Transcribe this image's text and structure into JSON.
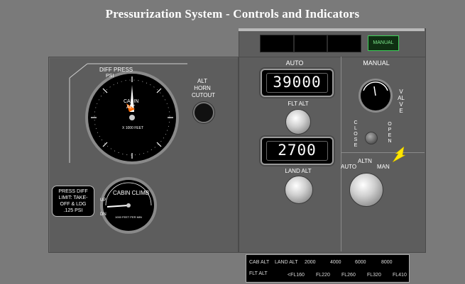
{
  "title": "Pressurization System - Controls and Indicators",
  "top_windows": {
    "manual_button": "MANUAL"
  },
  "left_panel": {
    "diff_press_gauge": {
      "label_top": "DIFF PRESS",
      "label_psi": "PSI",
      "label_cabin": "CABIN",
      "label_alt": "ALT",
      "label_feet": "X 1000 FEET",
      "scale_values": [
        "0",
        "5",
        "10",
        "15",
        "20",
        "25",
        "30",
        "35",
        "40",
        "45",
        "50"
      ],
      "psi_values": [
        "0",
        "2",
        "4",
        "6",
        "8",
        "10"
      ]
    },
    "alt_horn_cutout": {
      "line1": "ALT",
      "line2": "HORN",
      "line3": "CUTOUT"
    },
    "press_diff_limit": {
      "line1": "PRESS DIFF",
      "line2": "LIMIT: TAKE-",
      "line3": "OFF & LDG",
      "line4": ".125 PSI"
    },
    "cabin_climb_gauge": {
      "label": "CABIN CLIMB",
      "label_sub": "1000 FEET PER MIN",
      "up": "UP",
      "dn": "DN",
      "values": [
        "0",
        "1",
        "2",
        "3",
        "4",
        "1",
        "2",
        "3",
        "4"
      ]
    }
  },
  "right_panel": {
    "auto_label": "AUTO",
    "manual_label": "MANUAL",
    "flt_alt_display": "39000",
    "flt_alt_label": "FLT ALT",
    "land_alt_display": "2700",
    "land_alt_label": "LAND ALT",
    "valve_label": "VALVE",
    "close_label": "CLOSE",
    "open_label": "OPEN",
    "mode_auto": "AUTO",
    "mode_altn": "ALTN",
    "mode_man": "MAN"
  },
  "table": {
    "row1_label1": "CAB ALT",
    "row1_label2": "LAND ALT",
    "row2_label": "FLT ALT",
    "cab_values": [
      "2000",
      "4000",
      "6000",
      "8000"
    ],
    "flt_values": [
      "<FL160",
      "FL220",
      "FL260",
      "FL320",
      "FL410"
    ]
  },
  "colors": {
    "accent_arrow": "#ffe600",
    "manual_green": "#3fcf5a",
    "needle_orange": "#ff6a00"
  }
}
